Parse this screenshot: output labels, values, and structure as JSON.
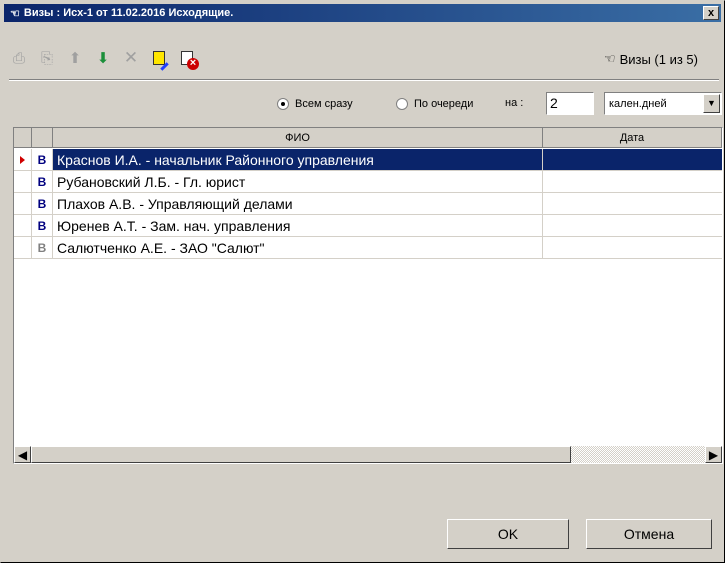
{
  "window": {
    "title": "Визы : Исх-1 от 11.02.2016 Исходящие.",
    "close_label": "x"
  },
  "toolbar": {
    "buttons": [
      {
        "icon": "add-doc-icon",
        "glyph": "⎙"
      },
      {
        "icon": "add-many-icon",
        "glyph": "⎘"
      },
      {
        "icon": "arrow-up-icon",
        "glyph": "⬆"
      },
      {
        "icon": "arrow-down-icon",
        "glyph": "⬇"
      },
      {
        "icon": "delete-cross-icon",
        "glyph": "✕"
      },
      {
        "icon": "edit-doc-icon",
        "glyph": ""
      },
      {
        "icon": "remove-doc-icon",
        "glyph": ""
      }
    ],
    "status_icon": "hand-icon",
    "status_glyph": "☜",
    "status_text": "Визы (1 из 5)"
  },
  "options": {
    "all_at_once": "Всем сразу",
    "in_turn": "По очереди",
    "selected": "all_at_once",
    "na_label": "на :",
    "days_value": "2",
    "days_unit": "кален.дней",
    "dropdown_glyph": "▼"
  },
  "grid": {
    "columns": [
      "",
      "",
      "ФИО",
      "Дата"
    ],
    "rows": [
      {
        "flag": "В",
        "name": "Краснов И.А. - начальник Районного управления",
        "date": "",
        "selected": true,
        "grey": false
      },
      {
        "flag": "В",
        "name": "Рубановский Л.Б. - Гл. юрист",
        "date": "",
        "selected": false,
        "grey": false
      },
      {
        "flag": "В",
        "name": "Плахов А.В. - Управляющий делами",
        "date": "",
        "selected": false,
        "grey": false
      },
      {
        "flag": "В",
        "name": "Юренев А.Т. - Зам. нач. управления",
        "date": "",
        "selected": false,
        "grey": false
      },
      {
        "flag": "В",
        "name": "Салютченко А.Е. - ЗАО \"Салют\"",
        "date": "",
        "selected": false,
        "grey": true
      }
    ],
    "scroll_left_glyph": "◀",
    "scroll_right_glyph": "▶"
  },
  "buttons": {
    "ok": "OK",
    "cancel": "Отмена"
  }
}
